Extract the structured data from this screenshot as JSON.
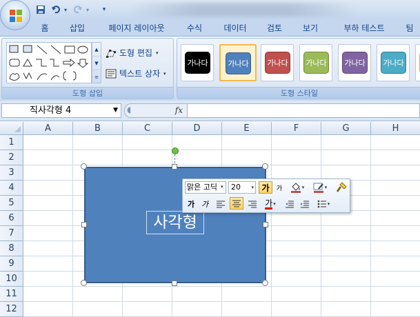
{
  "tabs": [
    {
      "label": "홈",
      "active": false
    },
    {
      "label": "삽입",
      "active": false
    },
    {
      "label": "페이지 레이아웃",
      "active": false
    },
    {
      "label": "수식",
      "active": false
    },
    {
      "label": "데이터",
      "active": false
    },
    {
      "label": "검토",
      "active": false
    },
    {
      "label": "보기",
      "active": false
    },
    {
      "label": "부하 테스트",
      "active": false
    },
    {
      "label": "팀",
      "active": false
    }
  ],
  "ribbon": {
    "insert_shapes": {
      "label": "도형 삽입",
      "edit_shape_label": "도형 편집",
      "text_box_label": "텍스트 상자"
    },
    "shape_styles": {
      "label": "도형 스타일",
      "thumbs": [
        {
          "text": "가나다",
          "color": "#000000",
          "selected": false
        },
        {
          "text": "가나다",
          "color": "#4f81bd",
          "selected": true
        },
        {
          "text": "가나다",
          "color": "#c0504d",
          "selected": false
        },
        {
          "text": "가나다",
          "color": "#9bbb59",
          "selected": false
        },
        {
          "text": "가나다",
          "color": "#8064a2",
          "selected": false
        },
        {
          "text": "가나다",
          "color": "#4bacc6",
          "selected": false
        }
      ]
    }
  },
  "formula_bar": {
    "name_box": "직사각형 4",
    "fx_label": "fx",
    "formula": ""
  },
  "sheet": {
    "columns": [
      "A",
      "B",
      "C",
      "D",
      "E",
      "F",
      "G",
      "H"
    ],
    "rows": [
      "1",
      "2",
      "3",
      "4",
      "5",
      "6",
      "7",
      "8",
      "9",
      "10",
      "11",
      "12"
    ]
  },
  "shape": {
    "text": "사각형",
    "fill": "#4f81bd"
  },
  "mini_toolbar": {
    "font": "맑은 고딕",
    "size": "20",
    "grow_font": "가",
    "shrink_font": "가",
    "bold": "가",
    "italic": "가",
    "font_color_glyph": "가"
  },
  "colors": {
    "ribbon_text": "#15428b",
    "accent_selected": "#f2b94c",
    "shape_border": "#385d8a"
  }
}
